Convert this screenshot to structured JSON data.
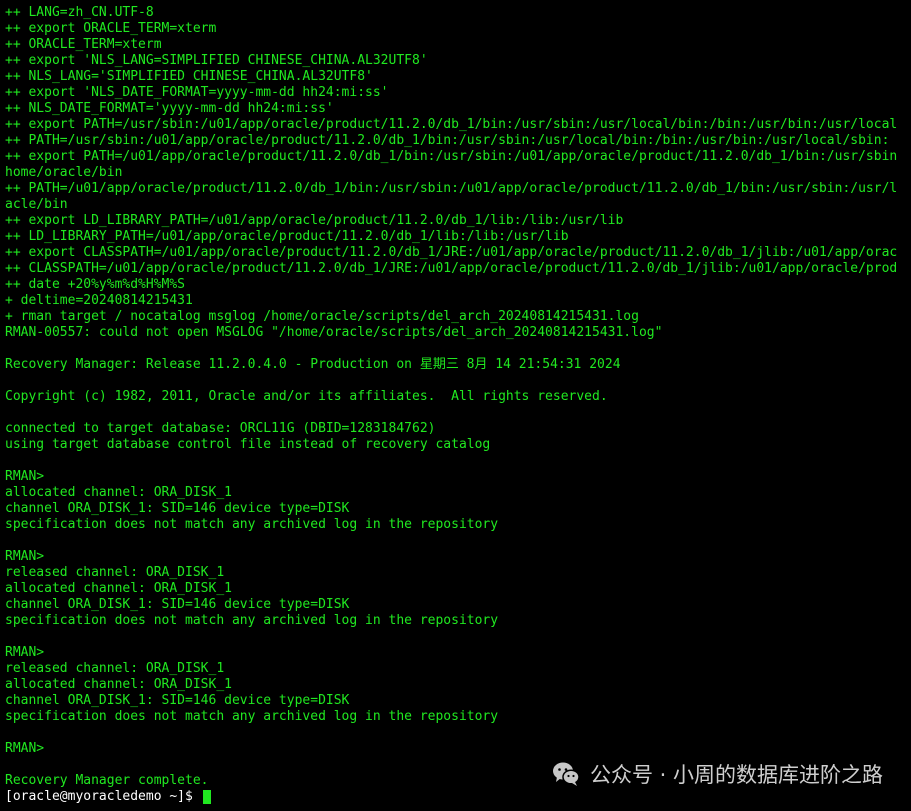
{
  "terminal": {
    "lines": [
      "++ LANG=zh_CN.UTF-8",
      "++ export ORACLE_TERM=xterm",
      "++ ORACLE_TERM=xterm",
      "++ export 'NLS_LANG=SIMPLIFIED CHINESE_CHINA.AL32UTF8'",
      "++ NLS_LANG='SIMPLIFIED CHINESE_CHINA.AL32UTF8'",
      "++ export 'NLS_DATE_FORMAT=yyyy-mm-dd hh24:mi:ss'",
      "++ NLS_DATE_FORMAT='yyyy-mm-dd hh24:mi:ss'",
      "++ export PATH=/usr/sbin:/u01/app/oracle/product/11.2.0/db_1/bin:/usr/sbin:/usr/local/bin:/bin:/usr/bin:/usr/local",
      "++ PATH=/usr/sbin:/u01/app/oracle/product/11.2.0/db_1/bin:/usr/sbin:/usr/local/bin:/bin:/usr/bin:/usr/local/sbin:",
      "++ export PATH=/u01/app/oracle/product/11.2.0/db_1/bin:/usr/sbin:/u01/app/oracle/product/11.2.0/db_1/bin:/usr/sbin",
      "home/oracle/bin",
      "++ PATH=/u01/app/oracle/product/11.2.0/db_1/bin:/usr/sbin:/u01/app/oracle/product/11.2.0/db_1/bin:/usr/sbin:/usr/l",
      "acle/bin",
      "++ export LD_LIBRARY_PATH=/u01/app/oracle/product/11.2.0/db_1/lib:/lib:/usr/lib",
      "++ LD_LIBRARY_PATH=/u01/app/oracle/product/11.2.0/db_1/lib:/lib:/usr/lib",
      "++ export CLASSPATH=/u01/app/oracle/product/11.2.0/db_1/JRE:/u01/app/oracle/product/11.2.0/db_1/jlib:/u01/app/orac",
      "++ CLASSPATH=/u01/app/oracle/product/11.2.0/db_1/JRE:/u01/app/oracle/product/11.2.0/db_1/jlib:/u01/app/oracle/prod",
      "++ date +20%y%m%d%H%M%S",
      "+ deltime=20240814215431",
      "+ rman target / nocatalog msglog /home/oracle/scripts/del_arch_20240814215431.log",
      "RMAN-00557: could not open MSGLOG \"/home/oracle/scripts/del_arch_20240814215431.log\"",
      "",
      "Recovery Manager: Release 11.2.0.4.0 - Production on 星期三 8月 14 21:54:31 2024",
      "",
      "Copyright (c) 1982, 2011, Oracle and/or its affiliates.  All rights reserved.",
      "",
      "connected to target database: ORCL11G (DBID=1283184762)",
      "using target database control file instead of recovery catalog",
      "",
      "RMAN>",
      "allocated channel: ORA_DISK_1",
      "channel ORA_DISK_1: SID=146 device type=DISK",
      "specification does not match any archived log in the repository",
      "",
      "RMAN>",
      "released channel: ORA_DISK_1",
      "allocated channel: ORA_DISK_1",
      "channel ORA_DISK_1: SID=146 device type=DISK",
      "specification does not match any archived log in the repository",
      "",
      "RMAN>",
      "released channel: ORA_DISK_1",
      "allocated channel: ORA_DISK_1",
      "channel ORA_DISK_1: SID=146 device type=DISK",
      "specification does not match any archived log in the repository",
      "",
      "RMAN>",
      "",
      "Recovery Manager complete."
    ],
    "prompt": "[oracle@myoracledemo ~]$ ",
    "text_color": "#20e820",
    "background_color": "#000000",
    "cursor_color": "#20e820"
  },
  "watermark": {
    "icon": "wechat-icon",
    "text": "公众号 · 小周的数据库进阶之路"
  }
}
